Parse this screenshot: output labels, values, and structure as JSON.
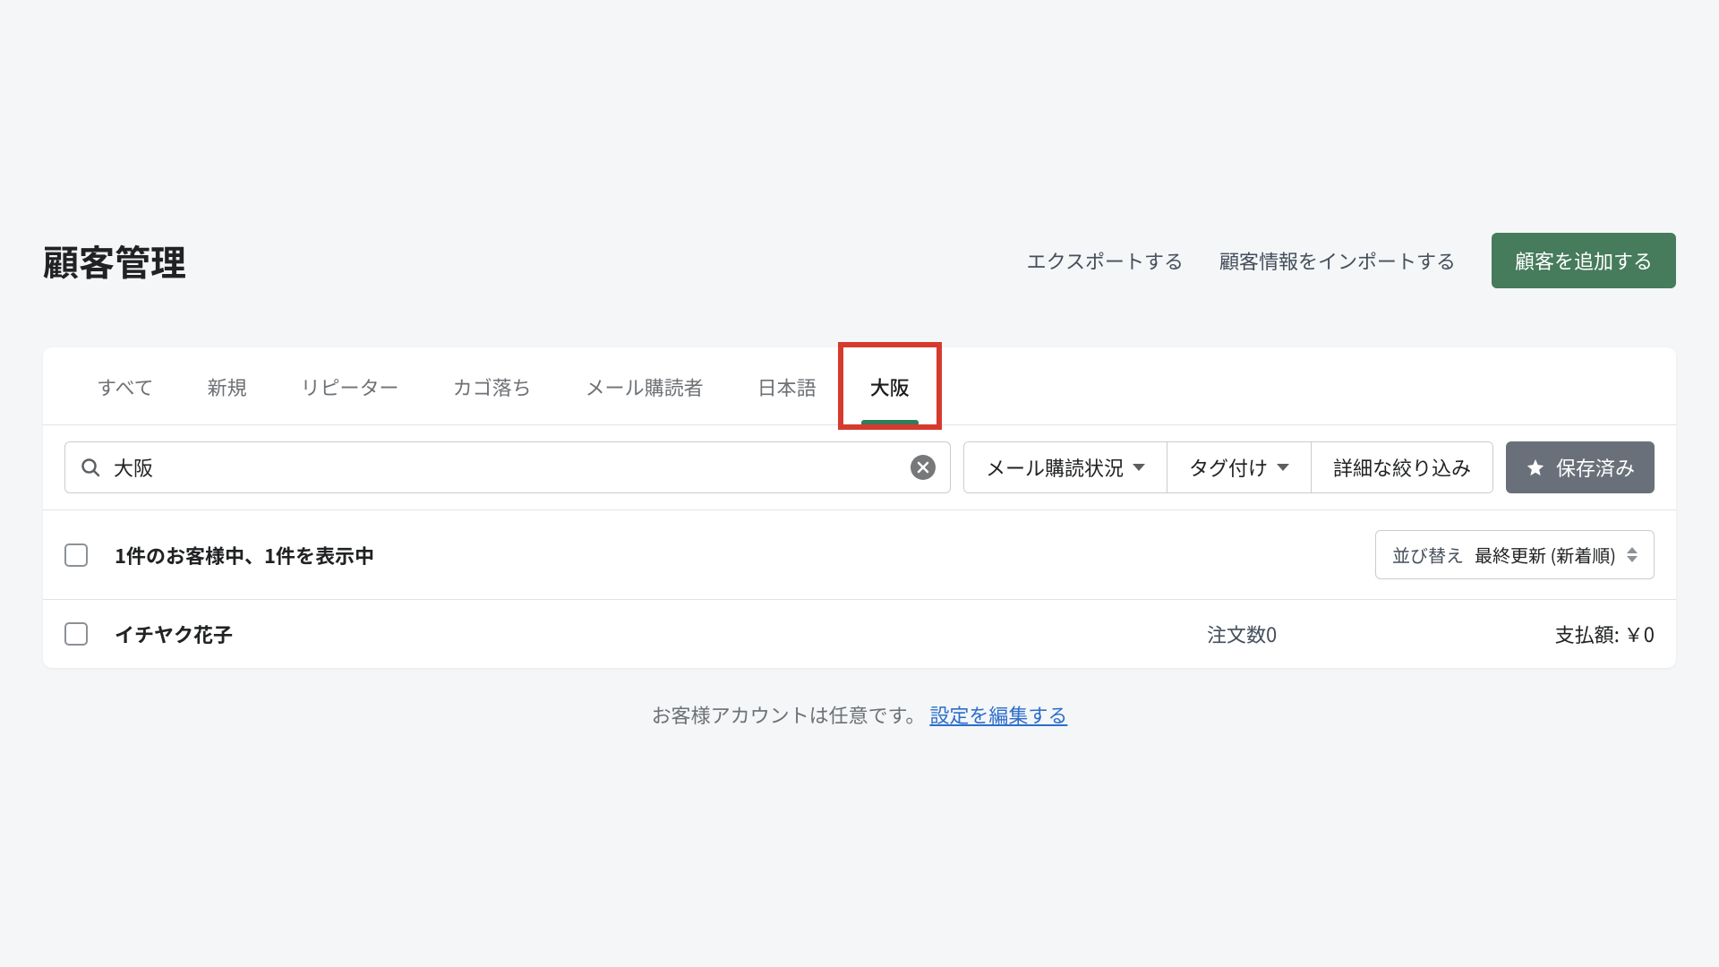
{
  "header": {
    "title": "顧客管理",
    "export_label": "エクスポートする",
    "import_label": "顧客情報をインポートする",
    "add_customer_label": "顧客を追加する"
  },
  "tabs": [
    {
      "label": "すべて",
      "active": false
    },
    {
      "label": "新規",
      "active": false
    },
    {
      "label": "リピーター",
      "active": false
    },
    {
      "label": "カゴ落ち",
      "active": false
    },
    {
      "label": "メール購読者",
      "active": false
    },
    {
      "label": "日本語",
      "active": false
    },
    {
      "label": "大阪",
      "active": true,
      "highlighted": true
    }
  ],
  "search": {
    "value": "大阪",
    "placeholder": ""
  },
  "filters": {
    "mail_status": "メール購読状況",
    "tagging": "タグ付け",
    "advanced": "詳細な絞り込み",
    "saved": "保存済み"
  },
  "list_summary": {
    "text": "1件のお客様中、1件を表示中",
    "sort_prefix": "並び替え",
    "sort_value": "最終更新 (新着順)"
  },
  "rows": [
    {
      "name": "イチヤク花子",
      "orders": "注文数0",
      "paid": "支払額: ￥0"
    }
  ],
  "footer": {
    "note": "お客様アカウントは任意です。",
    "link": "設定を編集する"
  }
}
